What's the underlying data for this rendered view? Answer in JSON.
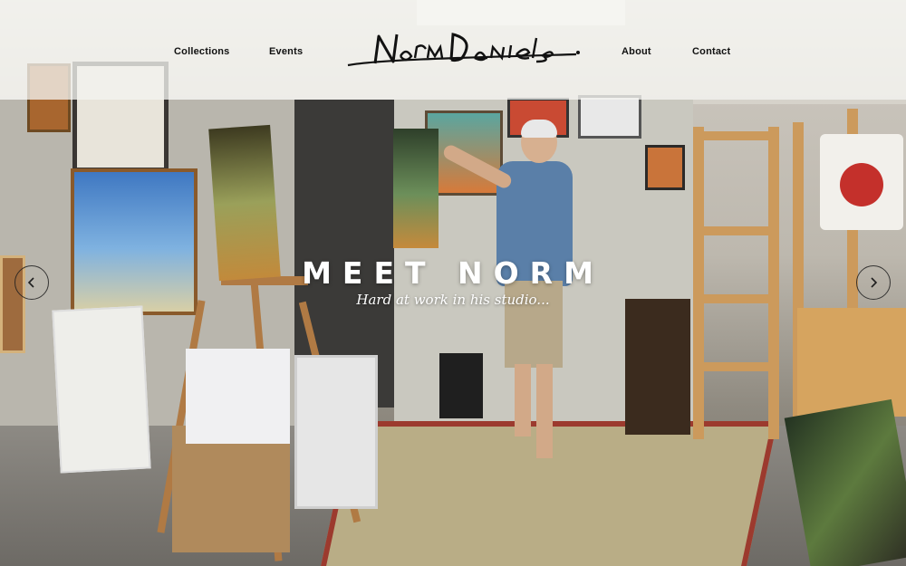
{
  "nav": {
    "collections": "Collections",
    "events": "Events",
    "about": "About",
    "contact": "Contact"
  },
  "brand": {
    "logo_text": "NormDaniels"
  },
  "hero": {
    "title": "MEET NORM",
    "subtitle": "Hard at work in his studio...",
    "prev_icon": "chevron-left-icon",
    "next_icon": "chevron-right-icon"
  },
  "colors": {
    "header_bg": "#f4f3f0",
    "nav_text": "#111111",
    "hero_text": "#ffffff",
    "arrow_border": "#1e1e1e"
  }
}
